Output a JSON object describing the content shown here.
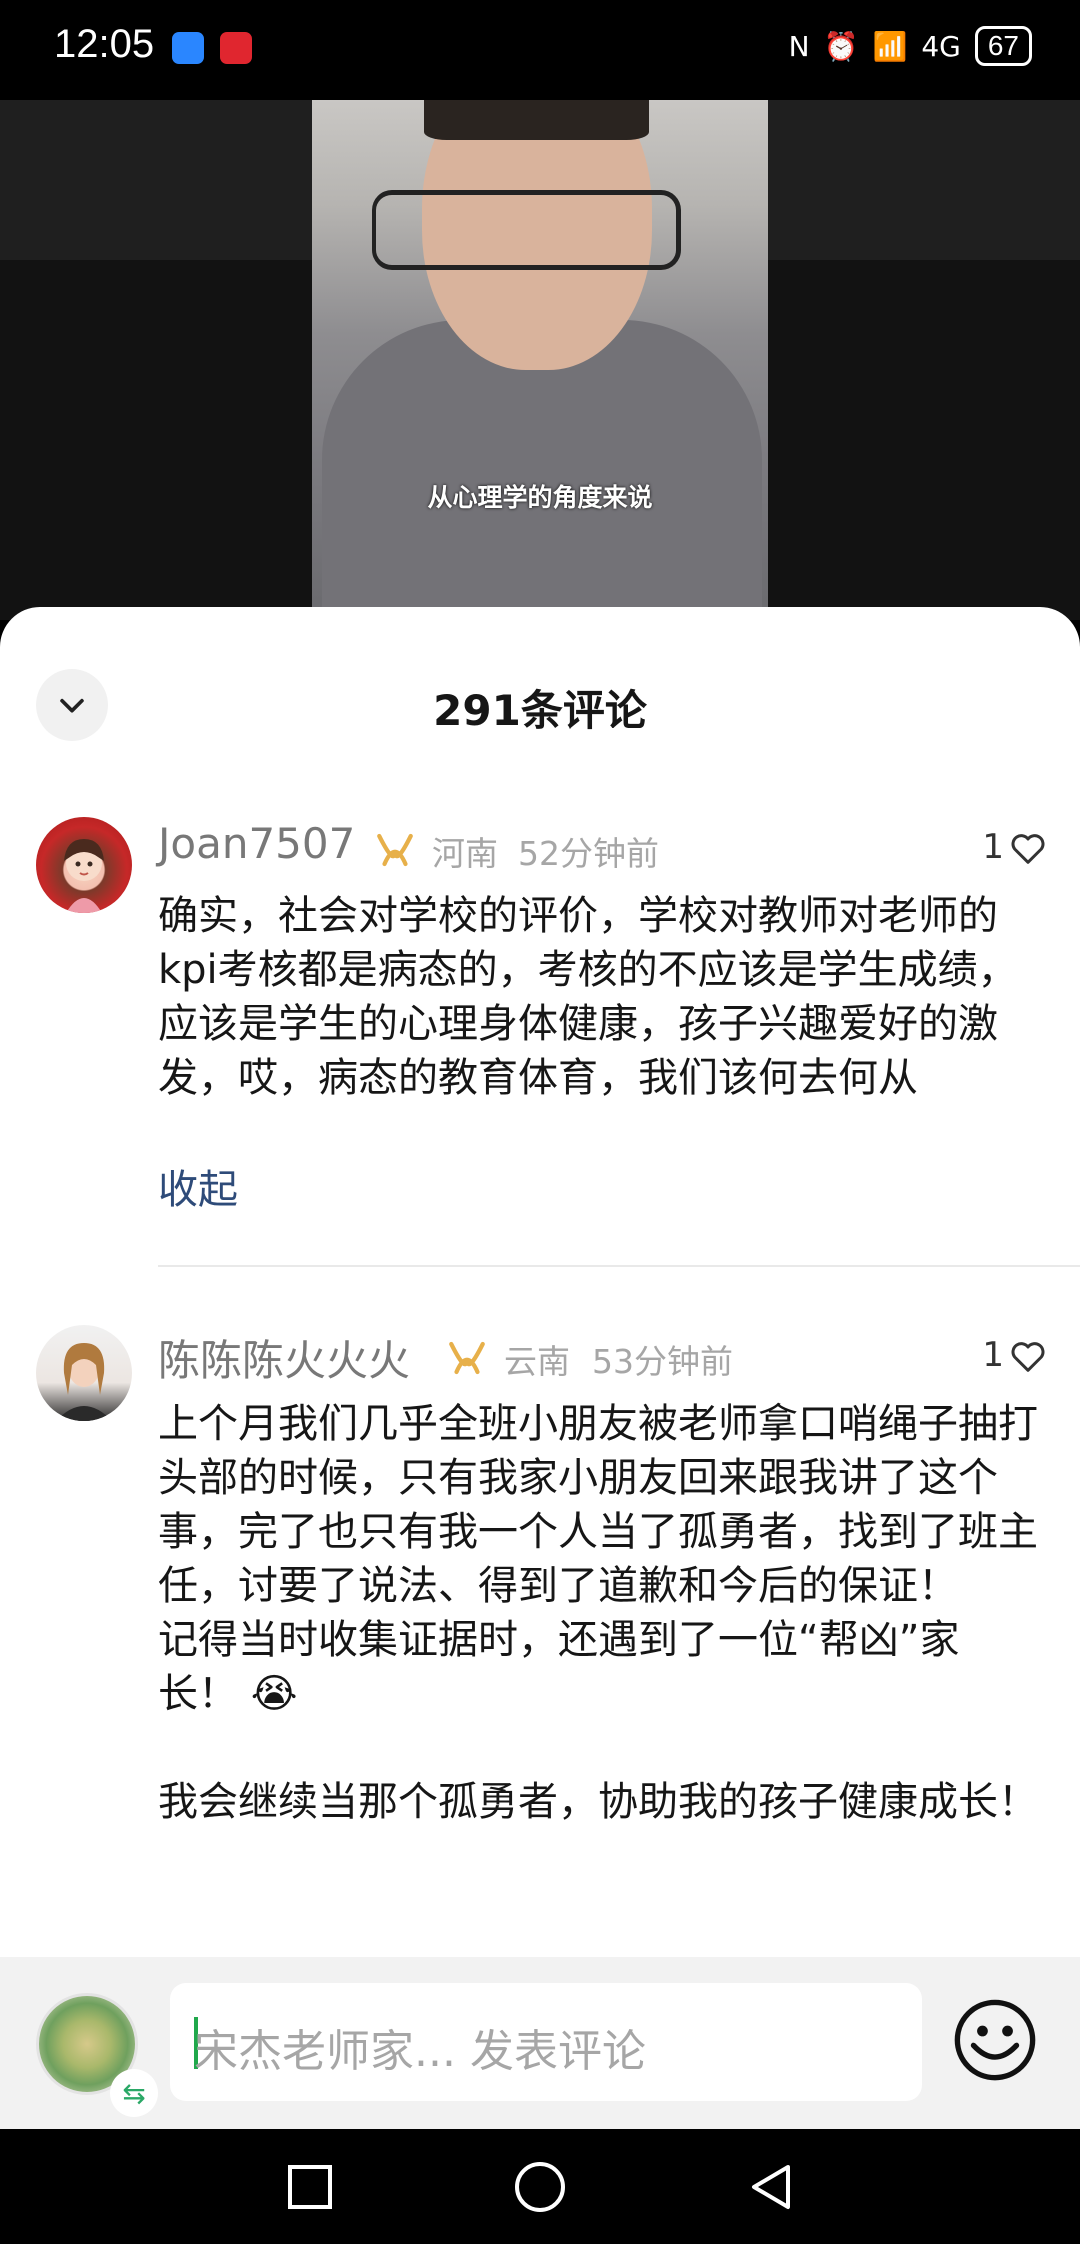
{
  "status_bar": {
    "time": "12:05",
    "battery": "67",
    "network": "4G"
  },
  "video": {
    "caption": "从心理学的角度来说"
  },
  "comments_panel": {
    "title": "291条评论",
    "comments": [
      {
        "username": "Joan7507",
        "location": "河南",
        "time": "52分钟前",
        "likes": "1",
        "text": "确实，社会对学校的评价，学校对教师对老师的kpi考核都是病态的，考核的不应该是学生成绩，应该是学生的心理身体健康，孩子兴趣爱好的激发，哎，病态的教育体育，我们该何去何从",
        "collapse_label": "收起"
      },
      {
        "username": "陈陈陈火火火",
        "location": "云南",
        "time": "53分钟前",
        "likes": "1",
        "text": "上个月我们几乎全班小朋友被老师拿口哨绳子抽打头部的时候，只有我家小朋友回来跟我讲了这个事，完了也只有我一个人当了孤勇者，找到了班主任，讨要了说法、得到了道歉和今后的保证！\n记得当时收集证据时，还遇到了一位“帮凶”家长！ 😭\n\n我会继续当那个孤勇者，协助我的孩子健康成长！"
      }
    ]
  },
  "input_bar": {
    "placeholder": "宋杰老师家... 发表评论"
  },
  "icons": {
    "badge": "badge-icon",
    "heart": "heart-icon",
    "emoji": "emoji-icon",
    "collapse": "chevron-down-icon"
  },
  "colors": {
    "badge": "#e7b04a",
    "link": "#2e4b79",
    "caret": "#20a84b"
  }
}
